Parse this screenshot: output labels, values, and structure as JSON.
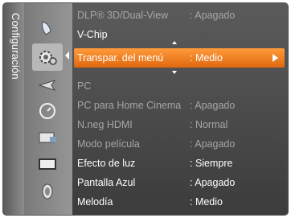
{
  "sidebar": {
    "title": "Configuración"
  },
  "categories": [
    {
      "icon": "picture-icon"
    },
    {
      "icon": "setup-gear-icon"
    },
    {
      "icon": "input-antenna-icon"
    },
    {
      "icon": "clock-icon"
    },
    {
      "icon": "channel-icon"
    },
    {
      "icon": "screen-icon"
    },
    {
      "icon": "sound-speaker-icon"
    }
  ],
  "menu": {
    "items": [
      {
        "label": "DLP® 3D/Dual-View",
        "value": ": Apagado",
        "state": "dim"
      },
      {
        "label": "V-Chip",
        "value": "",
        "state": "on"
      },
      {
        "label": "Transpar. del menú",
        "value": ": Medio",
        "state": "selected"
      },
      {
        "label": "PC",
        "value": "",
        "state": "dim"
      },
      {
        "label": "PC para Home Cinema",
        "value": ": Apagado",
        "state": "dim"
      },
      {
        "label": "N.neg HDMI",
        "value": ": Normal",
        "state": "dim"
      },
      {
        "label": "Modo película",
        "value": ": Apagado",
        "state": "dim"
      },
      {
        "label": "Efecto de luz",
        "value": ": Siempre",
        "state": "on"
      },
      {
        "label": "Pantalla Azul",
        "value": ": Apagado",
        "state": "on"
      },
      {
        "label": "Melodía",
        "value": ": Medio",
        "state": "on"
      }
    ]
  },
  "colors": {
    "highlight": "#f07a1c",
    "panel": "#4a4a4a",
    "disabled_text": "#a6a6a6"
  }
}
